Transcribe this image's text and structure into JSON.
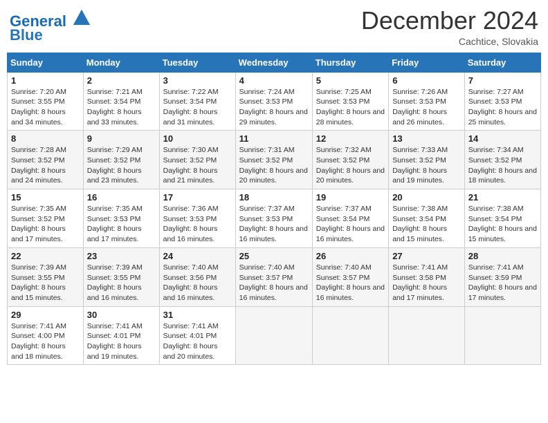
{
  "header": {
    "logo_line1": "General",
    "logo_line2": "Blue",
    "month": "December 2024",
    "location": "Cachtice, Slovakia"
  },
  "weekdays": [
    "Sunday",
    "Monday",
    "Tuesday",
    "Wednesday",
    "Thursday",
    "Friday",
    "Saturday"
  ],
  "weeks": [
    [
      {
        "day": "1",
        "sunrise": "7:20 AM",
        "sunset": "3:55 PM",
        "daylight": "8 hours and 34 minutes."
      },
      {
        "day": "2",
        "sunrise": "7:21 AM",
        "sunset": "3:54 PM",
        "daylight": "8 hours and 33 minutes."
      },
      {
        "day": "3",
        "sunrise": "7:22 AM",
        "sunset": "3:54 PM",
        "daylight": "8 hours and 31 minutes."
      },
      {
        "day": "4",
        "sunrise": "7:24 AM",
        "sunset": "3:53 PM",
        "daylight": "8 hours and 29 minutes."
      },
      {
        "day": "5",
        "sunrise": "7:25 AM",
        "sunset": "3:53 PM",
        "daylight": "8 hours and 28 minutes."
      },
      {
        "day": "6",
        "sunrise": "7:26 AM",
        "sunset": "3:53 PM",
        "daylight": "8 hours and 26 minutes."
      },
      {
        "day": "7",
        "sunrise": "7:27 AM",
        "sunset": "3:53 PM",
        "daylight": "8 hours and 25 minutes."
      }
    ],
    [
      {
        "day": "8",
        "sunrise": "7:28 AM",
        "sunset": "3:52 PM",
        "daylight": "8 hours and 24 minutes."
      },
      {
        "day": "9",
        "sunrise": "7:29 AM",
        "sunset": "3:52 PM",
        "daylight": "8 hours and 23 minutes."
      },
      {
        "day": "10",
        "sunrise": "7:30 AM",
        "sunset": "3:52 PM",
        "daylight": "8 hours and 21 minutes."
      },
      {
        "day": "11",
        "sunrise": "7:31 AM",
        "sunset": "3:52 PM",
        "daylight": "8 hours and 20 minutes."
      },
      {
        "day": "12",
        "sunrise": "7:32 AM",
        "sunset": "3:52 PM",
        "daylight": "8 hours and 20 minutes."
      },
      {
        "day": "13",
        "sunrise": "7:33 AM",
        "sunset": "3:52 PM",
        "daylight": "8 hours and 19 minutes."
      },
      {
        "day": "14",
        "sunrise": "7:34 AM",
        "sunset": "3:52 PM",
        "daylight": "8 hours and 18 minutes."
      }
    ],
    [
      {
        "day": "15",
        "sunrise": "7:35 AM",
        "sunset": "3:52 PM",
        "daylight": "8 hours and 17 minutes."
      },
      {
        "day": "16",
        "sunrise": "7:35 AM",
        "sunset": "3:53 PM",
        "daylight": "8 hours and 17 minutes."
      },
      {
        "day": "17",
        "sunrise": "7:36 AM",
        "sunset": "3:53 PM",
        "daylight": "8 hours and 16 minutes."
      },
      {
        "day": "18",
        "sunrise": "7:37 AM",
        "sunset": "3:53 PM",
        "daylight": "8 hours and 16 minutes."
      },
      {
        "day": "19",
        "sunrise": "7:37 AM",
        "sunset": "3:54 PM",
        "daylight": "8 hours and 16 minutes."
      },
      {
        "day": "20",
        "sunrise": "7:38 AM",
        "sunset": "3:54 PM",
        "daylight": "8 hours and 15 minutes."
      },
      {
        "day": "21",
        "sunrise": "7:38 AM",
        "sunset": "3:54 PM",
        "daylight": "8 hours and 15 minutes."
      }
    ],
    [
      {
        "day": "22",
        "sunrise": "7:39 AM",
        "sunset": "3:55 PM",
        "daylight": "8 hours and 15 minutes."
      },
      {
        "day": "23",
        "sunrise": "7:39 AM",
        "sunset": "3:55 PM",
        "daylight": "8 hours and 16 minutes."
      },
      {
        "day": "24",
        "sunrise": "7:40 AM",
        "sunset": "3:56 PM",
        "daylight": "8 hours and 16 minutes."
      },
      {
        "day": "25",
        "sunrise": "7:40 AM",
        "sunset": "3:57 PM",
        "daylight": "8 hours and 16 minutes."
      },
      {
        "day": "26",
        "sunrise": "7:40 AM",
        "sunset": "3:57 PM",
        "daylight": "8 hours and 16 minutes."
      },
      {
        "day": "27",
        "sunrise": "7:41 AM",
        "sunset": "3:58 PM",
        "daylight": "8 hours and 17 minutes."
      },
      {
        "day": "28",
        "sunrise": "7:41 AM",
        "sunset": "3:59 PM",
        "daylight": "8 hours and 17 minutes."
      }
    ],
    [
      {
        "day": "29",
        "sunrise": "7:41 AM",
        "sunset": "4:00 PM",
        "daylight": "8 hours and 18 minutes."
      },
      {
        "day": "30",
        "sunrise": "7:41 AM",
        "sunset": "4:01 PM",
        "daylight": "8 hours and 19 minutes."
      },
      {
        "day": "31",
        "sunrise": "7:41 AM",
        "sunset": "4:01 PM",
        "daylight": "8 hours and 20 minutes."
      },
      null,
      null,
      null,
      null
    ]
  ]
}
